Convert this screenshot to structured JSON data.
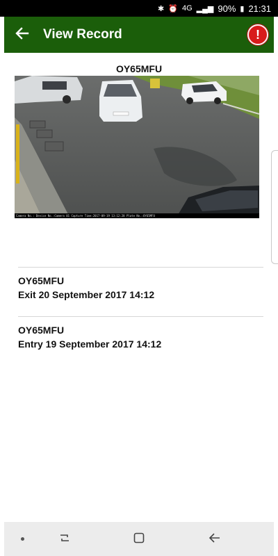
{
  "status_bar": {
    "network": "4G",
    "battery": "90%",
    "time": "21:31"
  },
  "app_bar": {
    "title": "View Record",
    "alert_symbol": "!",
    "color": "#1b5e0a"
  },
  "record": {
    "plate": "OY65MFU",
    "camera_caption": "Camera No.: Device No.:Camera 01 Capture Time:2017-09-19 13:12:28 Plate No.:OY65MFU"
  },
  "events": [
    {
      "plate": "OY65MFU",
      "text": "Exit 20 September 2017 14:12"
    },
    {
      "plate": "OY65MFU",
      "text": "Entry 19 September 2017 14:12"
    }
  ],
  "icons": {
    "back": "arrow-left-icon",
    "alert": "alert-icon",
    "recents": "recents-icon",
    "home": "home-icon",
    "nav_back": "nav-back-icon"
  }
}
